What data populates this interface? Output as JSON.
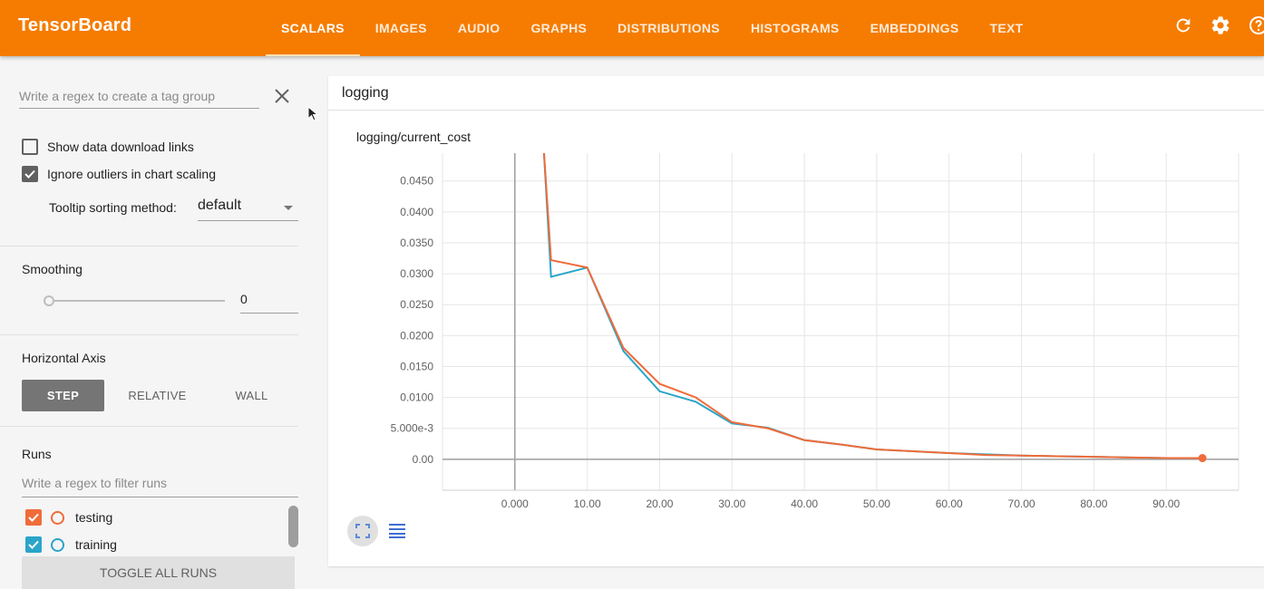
{
  "app": {
    "title": "TensorBoard"
  },
  "tabs": [
    {
      "label": "SCALARS",
      "active": true
    },
    {
      "label": "IMAGES",
      "active": false
    },
    {
      "label": "AUDIO",
      "active": false
    },
    {
      "label": "GRAPHS",
      "active": false
    },
    {
      "label": "DISTRIBUTIONS",
      "active": false
    },
    {
      "label": "HISTOGRAMS",
      "active": false
    },
    {
      "label": "EMBEDDINGS",
      "active": false
    },
    {
      "label": "TEXT",
      "active": false
    }
  ],
  "top_icons": [
    "refresh-icon",
    "settings-icon",
    "help-icon"
  ],
  "sidebar": {
    "tag_regex_placeholder": "Write a regex to create a tag group",
    "show_download_label": "Show data download links",
    "show_download_checked": false,
    "ignore_outliers_label": "Ignore outliers in chart scaling",
    "ignore_outliers_checked": true,
    "tooltip_sort_label": "Tooltip sorting method:",
    "tooltip_sort_value": "default",
    "smoothing_title": "Smoothing",
    "smoothing_value": "0",
    "horizontal_axis_title": "Horizontal Axis",
    "axis_options": [
      "STEP",
      "RELATIVE",
      "WALL"
    ],
    "axis_selected": "STEP",
    "runs_title": "Runs",
    "runs_filter_placeholder": "Write a regex to filter runs",
    "runs": [
      {
        "name": "testing",
        "checked": true,
        "color": "#ef6c3a"
      },
      {
        "name": "training",
        "checked": true,
        "color": "#2aa5c9"
      }
    ],
    "toggle_all_label": "TOGGLE ALL RUNS"
  },
  "main": {
    "group_name": "logging",
    "chart_title": "logging/current_cost"
  },
  "chart_data": {
    "type": "line",
    "title": "logging/current_cost",
    "xlabel": "",
    "ylabel": "",
    "xlim": [
      -10,
      100
    ],
    "ylim": [
      -0.005,
      0.0495
    ],
    "x_ticks": [
      "0.000",
      "10.00",
      "20.00",
      "30.00",
      "40.00",
      "50.00",
      "60.00",
      "70.00",
      "80.00",
      "90.00"
    ],
    "y_ticks": [
      "0.00",
      "5.000e-3",
      "0.0100",
      "0.0150",
      "0.0200",
      "0.0250",
      "0.0300",
      "0.0350",
      "0.0400",
      "0.0450"
    ],
    "grid": true,
    "series": [
      {
        "name": "training",
        "color": "#2aa5c9",
        "x": [
          4,
          5,
          10,
          15,
          20,
          25,
          30,
          35,
          40,
          45,
          50,
          55,
          60,
          65,
          70,
          75,
          80,
          85,
          90,
          95
        ],
        "y": [
          0.05,
          0.0295,
          0.031,
          0.0175,
          0.011,
          0.0093,
          0.0058,
          0.0051,
          0.0031,
          0.0024,
          0.0016,
          0.0013,
          0.001,
          0.0008,
          0.0006,
          0.0005,
          0.0004,
          0.0003,
          0.0002,
          0.0002
        ]
      },
      {
        "name": "testing",
        "color": "#ef6c3a",
        "x": [
          4,
          5,
          10,
          15,
          20,
          25,
          30,
          35,
          40,
          45,
          50,
          55,
          60,
          65,
          70,
          75,
          80,
          85,
          90,
          95
        ],
        "y": [
          0.05,
          0.0322,
          0.031,
          0.018,
          0.0122,
          0.01,
          0.006,
          0.005,
          0.0031,
          0.0024,
          0.0016,
          0.0013,
          0.001,
          0.0007,
          0.0006,
          0.0005,
          0.0004,
          0.0003,
          0.0002,
          0.0002
        ]
      }
    ]
  }
}
